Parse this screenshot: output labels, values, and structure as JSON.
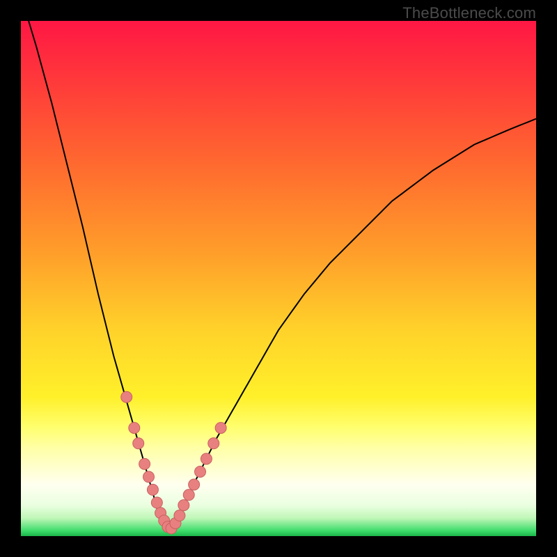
{
  "attribution": "TheBottleneck.com",
  "colors": {
    "frame": "#000000",
    "curve": "#000000",
    "marker_fill": "#e88080",
    "marker_stroke": "#c86060",
    "gradient_stops": [
      {
        "offset": 0.0,
        "color": "#ff1744"
      },
      {
        "offset": 0.12,
        "color": "#ff3a3a"
      },
      {
        "offset": 0.28,
        "color": "#ff6a2f"
      },
      {
        "offset": 0.45,
        "color": "#ff9e2a"
      },
      {
        "offset": 0.6,
        "color": "#ffd22a"
      },
      {
        "offset": 0.73,
        "color": "#fff02a"
      },
      {
        "offset": 0.79,
        "color": "#ffff70"
      },
      {
        "offset": 0.83,
        "color": "#ffffa8"
      },
      {
        "offset": 0.9,
        "color": "#fffff0"
      },
      {
        "offset": 0.94,
        "color": "#eaffe0"
      },
      {
        "offset": 0.965,
        "color": "#c0f7b8"
      },
      {
        "offset": 0.99,
        "color": "#3bdc6a"
      },
      {
        "offset": 1.0,
        "color": "#1bb54a"
      }
    ]
  },
  "chart_data": {
    "type": "line",
    "title": "",
    "xlabel": "",
    "ylabel": "",
    "xlim": [
      0,
      100
    ],
    "ylim": [
      0,
      100
    ],
    "grid": false,
    "legend": false,
    "description": "V-shaped bottleneck curve: high (bad/red) on both ends, dipping to near-zero (green) around x≈27–29. Right branch rises more slowly than the left.",
    "minimum_x": 28,
    "series": [
      {
        "name": "bottleneck-curve",
        "x": [
          0,
          3,
          6,
          9,
          12,
          15,
          18,
          20,
          22,
          24,
          26,
          27,
          28,
          29,
          30,
          32,
          35,
          38,
          42,
          46,
          50,
          55,
          60,
          66,
          72,
          80,
          88,
          95,
          100
        ],
        "values": [
          105,
          95,
          84,
          72,
          60,
          47,
          35,
          28,
          21,
          14,
          7,
          3,
          1,
          1,
          3,
          7,
          13,
          19,
          26,
          33,
          40,
          47,
          53,
          59,
          65,
          71,
          76,
          79,
          81
        ]
      }
    ],
    "markers": {
      "name": "highlight-points",
      "x": [
        20.5,
        22.0,
        22.8,
        24.0,
        24.8,
        25.6,
        26.4,
        27.1,
        27.8,
        28.5,
        29.2,
        30.0,
        30.8,
        31.6,
        32.6,
        33.6,
        34.8,
        36.0,
        37.4,
        38.8
      ],
      "values": [
        27.0,
        21.0,
        18.0,
        14.0,
        11.5,
        9.0,
        6.5,
        4.5,
        3.0,
        1.8,
        1.5,
        2.5,
        4.0,
        6.0,
        8.0,
        10.0,
        12.5,
        15.0,
        18.0,
        21.0
      ],
      "radius_px": 8
    }
  }
}
